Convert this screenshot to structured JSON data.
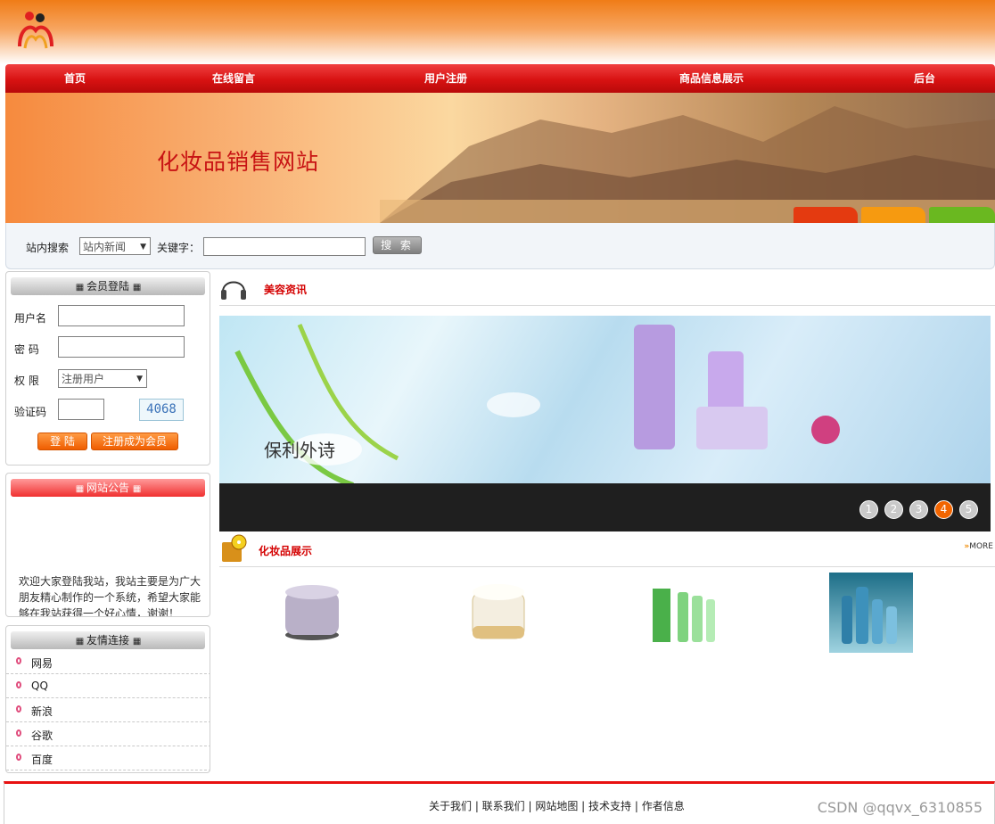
{
  "nav": {
    "items": [
      "首页",
      "在线留言",
      "用户注册",
      "商品信息展示",
      "后台"
    ]
  },
  "banner": {
    "title": "化妆品销售网站"
  },
  "search": {
    "label": "站内搜索",
    "category": "站内新闻",
    "keyword_label": "关键字：",
    "keyword_value": "",
    "button": "搜 索"
  },
  "login": {
    "title": "会员登陆",
    "username_label": "用户名",
    "password_label": "密 码",
    "role_label": "权 限",
    "role_value": "注册用户",
    "captcha_label": "验证码",
    "captcha_value": "4068",
    "login_button": "登 陆",
    "register_button": "注册成为会员"
  },
  "notice": {
    "title": "网站公告",
    "text": "欢迎大家登陆我站，我站主要是为广大朋友精心制作的一个系统，希望大家能够在我站获得一个好心情，谢谢！"
  },
  "links": {
    "title": "友情连接",
    "items": [
      "网易",
      "QQ",
      "新浪",
      "谷歌",
      "百度"
    ]
  },
  "news": {
    "title": "美容资讯",
    "pages": [
      "1",
      "2",
      "3",
      "4",
      "5"
    ],
    "active_page": "4"
  },
  "products": {
    "title": "化妆品展示",
    "more": "MORE"
  },
  "footer": {
    "links": "关于我们 | 联系我们 | 网站地图 | 技术支持 | 作者信息"
  },
  "watermark": "CSDN @qqvx_6310855",
  "colors": {
    "nav_red": "#d81212",
    "accent_orange": "#f07c17",
    "title_red": "#c81414"
  }
}
